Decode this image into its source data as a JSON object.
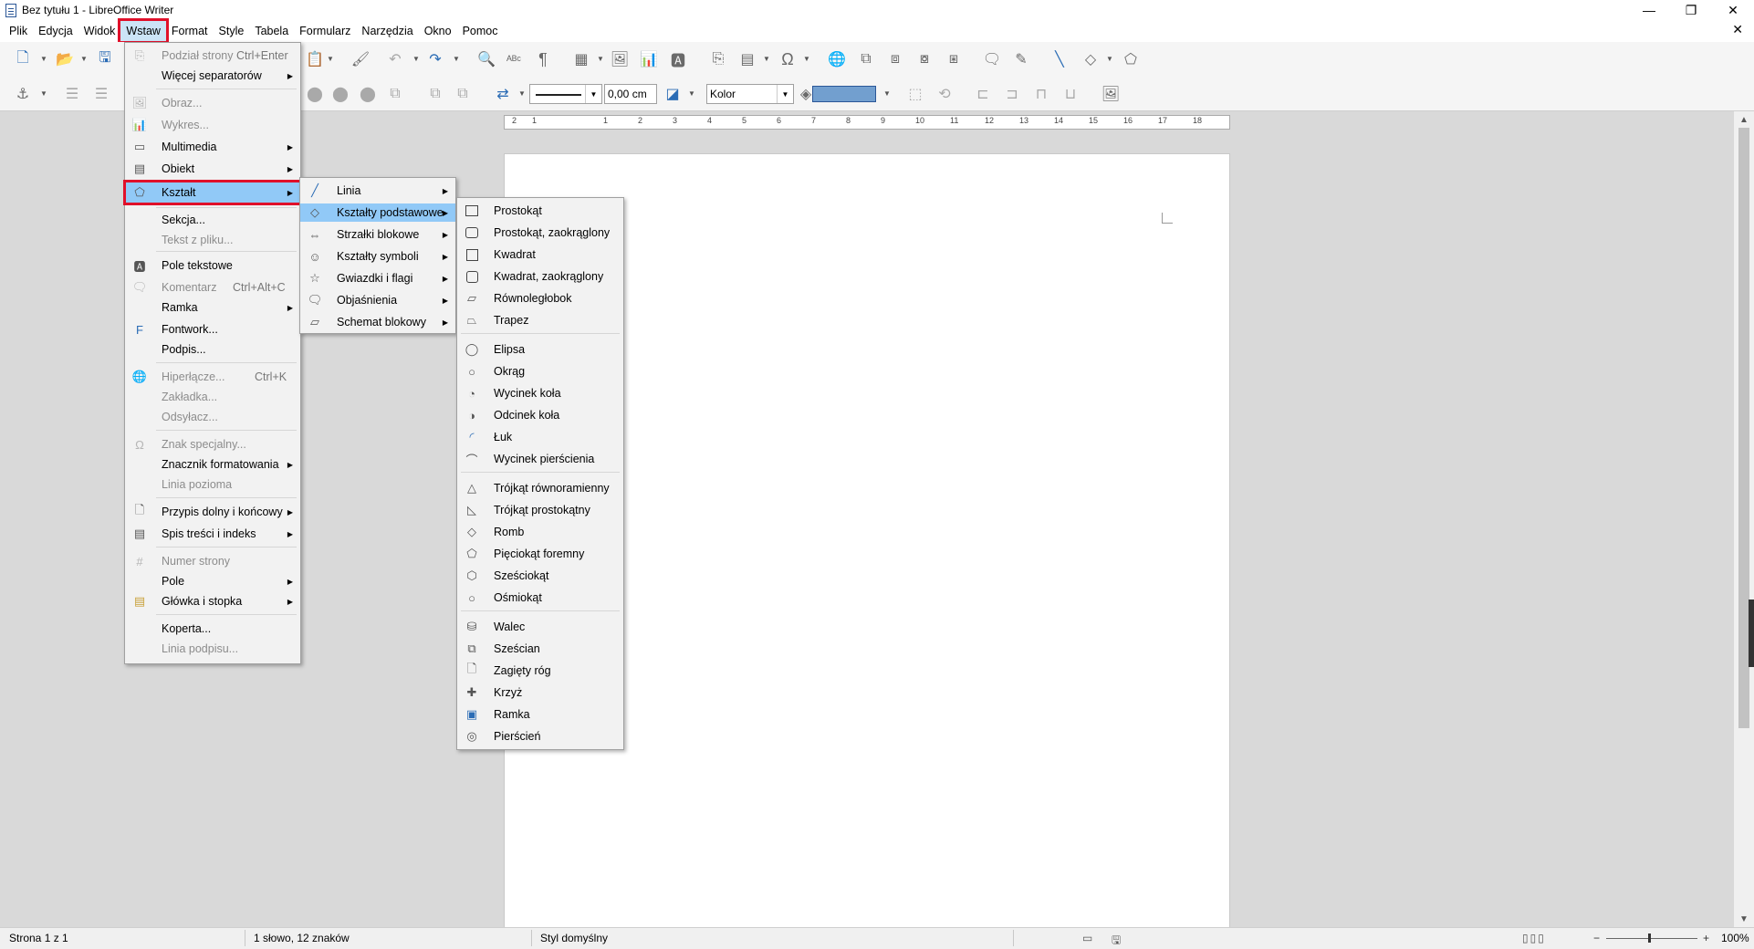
{
  "window": {
    "title": "Bez tytułu 1 - LibreOffice Writer",
    "controls": [
      "—",
      "❐",
      "✕"
    ]
  },
  "menubar": {
    "items": [
      "Plik",
      "Edycja",
      "Widok",
      "Wstaw",
      "Format",
      "Style",
      "Tabela",
      "Formularz",
      "Narzędzia",
      "Okno",
      "Pomoc"
    ],
    "active": "Wstaw",
    "close_doc": "✕"
  },
  "toolbar": {
    "line_width": "0,00 cm",
    "fill_style": "Kolor",
    "fill_color": "#729fcf"
  },
  "ruler": {
    "ticks": [
      "1",
      "2",
      "1",
      "2",
      "3",
      "4",
      "5",
      "6",
      "7",
      "8",
      "9",
      "10",
      "11",
      "12",
      "13",
      "14",
      "15",
      "16",
      "17",
      "18"
    ]
  },
  "insert_menu": {
    "items": [
      {
        "label": "Podział strony",
        "shortcut": "Ctrl+Enter",
        "disabled": true
      },
      {
        "label": "Więcej separatorów",
        "submenu": true
      },
      {
        "label": "Obraz...",
        "disabled": true
      },
      {
        "label": "Wykres...",
        "disabled": true
      },
      {
        "label": "Multimedia",
        "submenu": true
      },
      {
        "label": "Obiekt",
        "submenu": true
      },
      {
        "label": "Kształt",
        "submenu": true,
        "highlighted": true
      },
      {
        "label": "Sekcja..."
      },
      {
        "label": "Tekst z pliku...",
        "disabled": true
      },
      {
        "label": "Pole tekstowe"
      },
      {
        "label": "Komentarz",
        "shortcut": "Ctrl+Alt+C",
        "disabled": true
      },
      {
        "label": "Ramka",
        "submenu": true
      },
      {
        "label": "Fontwork..."
      },
      {
        "label": "Podpis..."
      },
      {
        "label": "Hiperłącze...",
        "shortcut": "Ctrl+K",
        "disabled": true
      },
      {
        "label": "Zakładka...",
        "disabled": true
      },
      {
        "label": "Odsyłacz...",
        "disabled": true
      },
      {
        "label": "Znak specjalny...",
        "disabled": true
      },
      {
        "label": "Znacznik formatowania",
        "submenu": true
      },
      {
        "label": "Linia pozioma",
        "disabled": true
      },
      {
        "label": "Przypis dolny i końcowy",
        "submenu": true
      },
      {
        "label": "Spis treści i indeks",
        "submenu": true
      },
      {
        "label": "Numer strony",
        "disabled": true
      },
      {
        "label": "Pole",
        "submenu": true
      },
      {
        "label": "Główka i stopka",
        "submenu": true
      },
      {
        "label": "Koperta..."
      },
      {
        "label": "Linia podpisu...",
        "disabled": true
      }
    ]
  },
  "shape_menu": {
    "items": [
      "Linia",
      "Kształty podstawowe",
      "Strzałki blokowe",
      "Kształty symboli",
      "Gwiazdki i flagi",
      "Objaśnienia",
      "Schemat blokowy"
    ],
    "highlighted": "Kształty podstawowe"
  },
  "basic_shapes_menu": {
    "items": [
      "Prostokąt",
      "Prostokąt, zaokrąglony",
      "Kwadrat",
      "Kwadrat, zaokrąglony",
      "Równoległobok",
      "Trapez",
      "Elipsa",
      "Okrąg",
      "Wycinek koła",
      "Odcinek koła",
      "Łuk",
      "Wycinek pierścienia",
      "Trójkąt równoramienny",
      "Trójkąt prostokątny",
      "Romb",
      "Pięciokąt foremny",
      "Sześciokąt",
      "Ośmiokąt",
      "Walec",
      "Sześcian",
      "Zagięty róg",
      "Krzyż",
      "Ramka",
      "Pierścień"
    ]
  },
  "statusbar": {
    "page": "Strona 1 z 1",
    "words": "1 słowo, 12 znaków",
    "style": "Styl domyślny",
    "zoom": "100%"
  }
}
